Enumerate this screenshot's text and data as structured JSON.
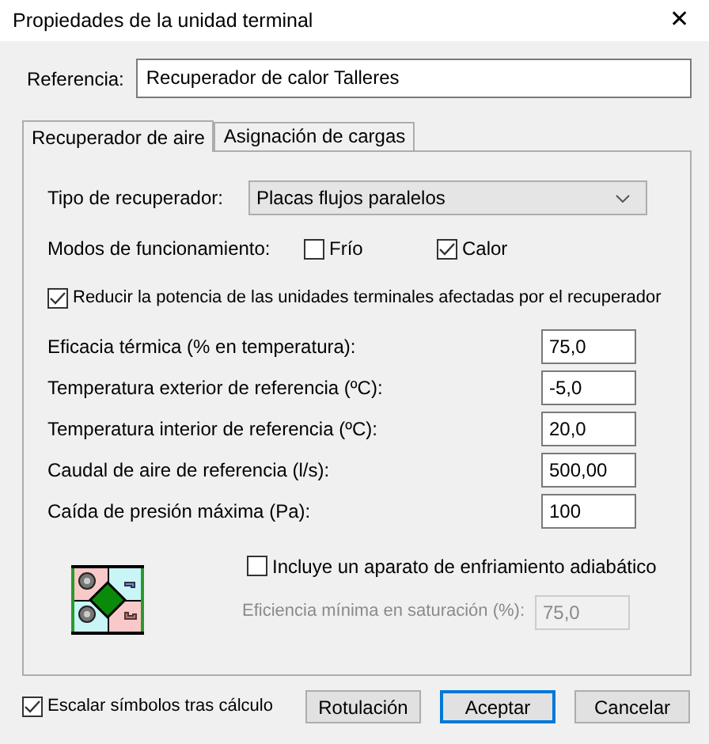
{
  "window": {
    "title": "Propiedades de la unidad terminal",
    "close": "✕"
  },
  "reference": {
    "label": "Referencia:",
    "value": "Recuperador de calor Talleres"
  },
  "tabs": [
    {
      "label": "Recuperador de aire",
      "selected": true
    },
    {
      "label": "Asignación de cargas",
      "selected": false
    }
  ],
  "recuperator_type": {
    "label": "Tipo de recuperador:",
    "value": "Placas flujos paralelos"
  },
  "modes": {
    "label": "Modos de funcionamiento:",
    "options": [
      {
        "label": "Frío",
        "checked": false
      },
      {
        "label": "Calor",
        "checked": true
      }
    ]
  },
  "reduce": {
    "label": "Reducir la potencia de las unidades terminales afectadas por el recuperador",
    "checked": true
  },
  "fields": [
    {
      "label": "Eficacia térmica (% en temperatura):",
      "value": "75,0"
    },
    {
      "label": "Temperatura exterior de referencia (ºC):",
      "value": "-5,0"
    },
    {
      "label": "Temperatura interior de referencia (ºC):",
      "value": "20,0"
    },
    {
      "label": "Caudal de aire de referencia (l/s):",
      "value": "500,00"
    },
    {
      "label": "Caída de presión máxima (Pa):",
      "value": "100"
    }
  ],
  "adiabatic": {
    "label": "Incluye un aparato de enfriamiento adiabático",
    "checked": false
  },
  "min_efficiency": {
    "label": "Eficiencia mínima en saturación (%):",
    "value": "75,0",
    "disabled": true
  },
  "scale": {
    "label": "Escalar símbolos tras cálculo",
    "checked": true
  },
  "buttons": [
    {
      "label": "Rotulación",
      "default": false
    },
    {
      "label": "Aceptar",
      "default": true
    },
    {
      "label": "Cancelar",
      "default": false
    }
  ]
}
